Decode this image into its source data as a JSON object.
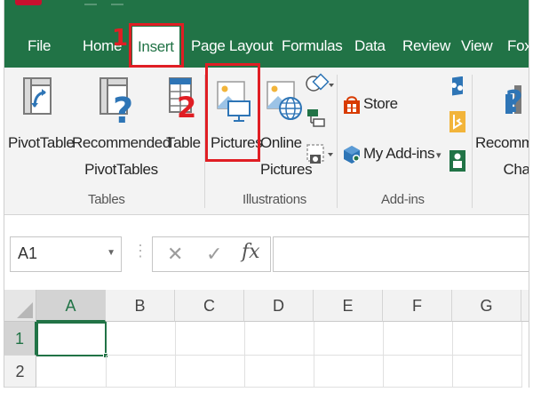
{
  "tabs": [
    {
      "label": "File"
    },
    {
      "label": "Home"
    },
    {
      "label": "Insert"
    },
    {
      "label": "Page Layout"
    },
    {
      "label": "Formulas"
    },
    {
      "label": "Data"
    },
    {
      "label": "Review"
    },
    {
      "label": "View"
    },
    {
      "label": "Fox"
    }
  ],
  "active_tab": "Insert",
  "callouts": {
    "first": "1",
    "second": "2"
  },
  "ribbon": {
    "tables_group": {
      "label": "Tables",
      "pivot_table": "PivotTable",
      "recommended_line1": "Recommended",
      "recommended_line2": "PivotTables",
      "table": "Table"
    },
    "illustrations_group": {
      "label": "Illustrations",
      "pictures": "Pictures",
      "online_line1": "Online",
      "online_line2": "Pictures"
    },
    "addins_group": {
      "label": "Add-ins",
      "store": "Store",
      "my_addins": "My Add-ins"
    },
    "charts_group": {
      "recommended_line1": "Recomme",
      "recommended_line2": "Chart"
    }
  },
  "formula_bar": {
    "name_box": "A1",
    "cancel_glyph": "✕",
    "enter_glyph": "✓",
    "fx_glyph": "fx",
    "formula": ""
  },
  "grid": {
    "columns": [
      "A",
      "B",
      "C",
      "D",
      "E",
      "F",
      "G"
    ],
    "rows": [
      "1",
      "2"
    ],
    "active_cell": "A1"
  },
  "icons": {
    "pivot_table": "pivot-table-icon",
    "recommended_pivot": "recommended-pivot-icon",
    "table": "table-icon",
    "pictures": "pictures-icon",
    "online_pictures": "online-pictures-icon",
    "shapes": "shapes-icon",
    "store": "store-icon",
    "my_addins": "my-addins-icon"
  },
  "colors": {
    "accent": "#217346",
    "callout": "#e01e24",
    "ribbon_bg": "#f3f3f3"
  }
}
